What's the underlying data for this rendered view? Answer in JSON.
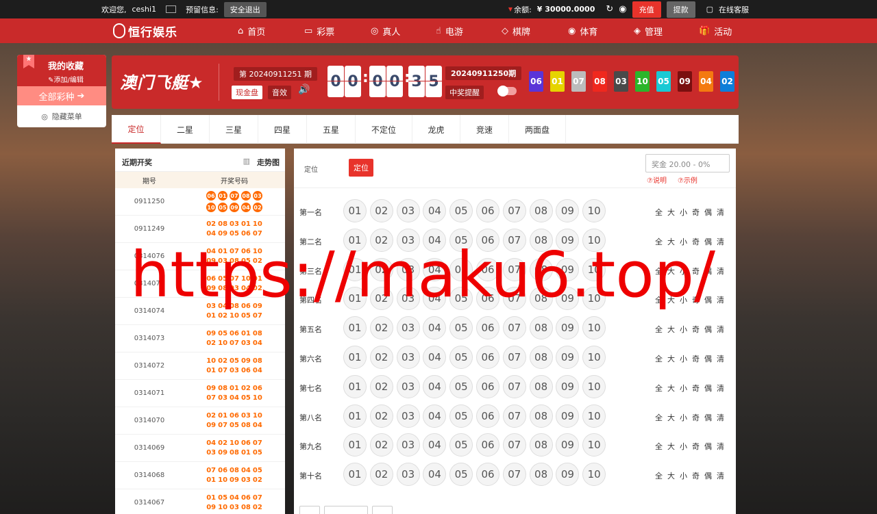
{
  "topbar": {
    "welcome": "欢迎您,",
    "user": "ceshi1",
    "reserve_label": "预留信息:",
    "logout": "安全退出",
    "balance_label": "余额:",
    "balance": "¥ 30000.0000",
    "deposit": "充值",
    "withdraw": "提款",
    "service": "在线客服"
  },
  "nav": {
    "logo": "恒行娱乐",
    "items": [
      {
        "label": "首页",
        "icon": "⌂"
      },
      {
        "label": "彩票",
        "icon": "▭"
      },
      {
        "label": "真人",
        "icon": "◎"
      },
      {
        "label": "电游",
        "icon": "☝"
      },
      {
        "label": "棋牌",
        "icon": "◇"
      },
      {
        "label": "体育",
        "icon": "◉"
      },
      {
        "label": "管理",
        "icon": "◈"
      },
      {
        "label": "活动",
        "icon": "🎁"
      }
    ]
  },
  "favorites": {
    "title": "我的收藏",
    "edit": "添加/编辑",
    "all": "全部彩种",
    "hide": "隐藏菜单"
  },
  "header": {
    "brand": "澳门飞艇",
    "period": "第 20240911251 期",
    "mode": "现金盘",
    "sound": "音效",
    "countdown": [
      "0",
      "0",
      "0",
      "0",
      "3",
      "5"
    ],
    "last_period": "20240911250期",
    "remind": "中奖提醒",
    "last_balls": [
      "06",
      "01",
      "07",
      "08",
      "03",
      "10",
      "05",
      "09",
      "04",
      "02"
    ],
    "ball_colors": {
      "01": "#e6d400",
      "02": "#0e7ed9",
      "03": "#4a4a4a",
      "04": "#f47a10",
      "05": "#1ac9d4",
      "06": "#5a34d8",
      "07": "#bcbcbc",
      "08": "#f0281e",
      "09": "#7a0f0f",
      "10": "#2bb52b"
    }
  },
  "tabs": [
    "定位",
    "二星",
    "三星",
    "四星",
    "五星",
    "不定位",
    "龙虎",
    "竞速",
    "两面盘"
  ],
  "recent": {
    "title": "近期开奖",
    "trend": "走势图",
    "col_period": "期号",
    "col_numbers": "开奖号码",
    "rows": [
      {
        "period": "0911250",
        "line1": [
          "06",
          "01",
          "07",
          "08",
          "03"
        ],
        "line2": [
          "10",
          "05",
          "09",
          "04",
          "02"
        ]
      },
      {
        "period": "0911249",
        "line1": [
          "02",
          "08",
          "03",
          "01",
          "10"
        ],
        "line2": [
          "04",
          "09",
          "05",
          "06",
          "07"
        ]
      },
      {
        "period": "0314076",
        "line1": [
          "04",
          "01",
          "07",
          "06",
          "10"
        ],
        "line2": [
          "09",
          "03",
          "08",
          "05",
          "02"
        ]
      },
      {
        "period": "0314075",
        "line1": [
          "06",
          "05",
          "07",
          "10",
          "01"
        ],
        "line2": [
          "09",
          "08",
          "03",
          "04",
          "02"
        ]
      },
      {
        "period": "0314074",
        "line1": [
          "03",
          "04",
          "08",
          "06",
          "09"
        ],
        "line2": [
          "01",
          "02",
          "10",
          "05",
          "07"
        ]
      },
      {
        "period": "0314073",
        "line1": [
          "09",
          "05",
          "06",
          "01",
          "08"
        ],
        "line2": [
          "02",
          "10",
          "07",
          "03",
          "04"
        ]
      },
      {
        "period": "0314072",
        "line1": [
          "10",
          "02",
          "05",
          "09",
          "08"
        ],
        "line2": [
          "01",
          "07",
          "03",
          "06",
          "04"
        ]
      },
      {
        "period": "0314071",
        "line1": [
          "09",
          "08",
          "01",
          "02",
          "06"
        ],
        "line2": [
          "07",
          "03",
          "04",
          "05",
          "10"
        ]
      },
      {
        "period": "0314070",
        "line1": [
          "02",
          "01",
          "06",
          "03",
          "10"
        ],
        "line2": [
          "09",
          "07",
          "05",
          "08",
          "04"
        ]
      },
      {
        "period": "0314069",
        "line1": [
          "04",
          "02",
          "10",
          "06",
          "07"
        ],
        "line2": [
          "03",
          "09",
          "08",
          "01",
          "05"
        ]
      },
      {
        "period": "0314068",
        "line1": [
          "07",
          "06",
          "08",
          "04",
          "05"
        ],
        "line2": [
          "01",
          "10",
          "09",
          "03",
          "02"
        ]
      },
      {
        "period": "0314067",
        "line1": [
          "01",
          "05",
          "04",
          "06",
          "07"
        ],
        "line2": [
          "09",
          "10",
          "03",
          "08",
          "02"
        ]
      }
    ]
  },
  "bet": {
    "label": "定位",
    "play": "定位",
    "odds": "奖金 20.00 - 0%",
    "help": "⑦说明",
    "example": "⑦示例",
    "ranks": [
      "第一名",
      "第二名",
      "第三名",
      "第四名",
      "第五名",
      "第六名",
      "第七名",
      "第八名",
      "第九名",
      "第十名"
    ],
    "numbers": [
      "01",
      "02",
      "03",
      "04",
      "05",
      "06",
      "07",
      "08",
      "09",
      "10"
    ],
    "quick": [
      "全",
      "大",
      "小",
      "奇",
      "偶",
      "清"
    ]
  },
  "watermark": "https://maku6.top/"
}
